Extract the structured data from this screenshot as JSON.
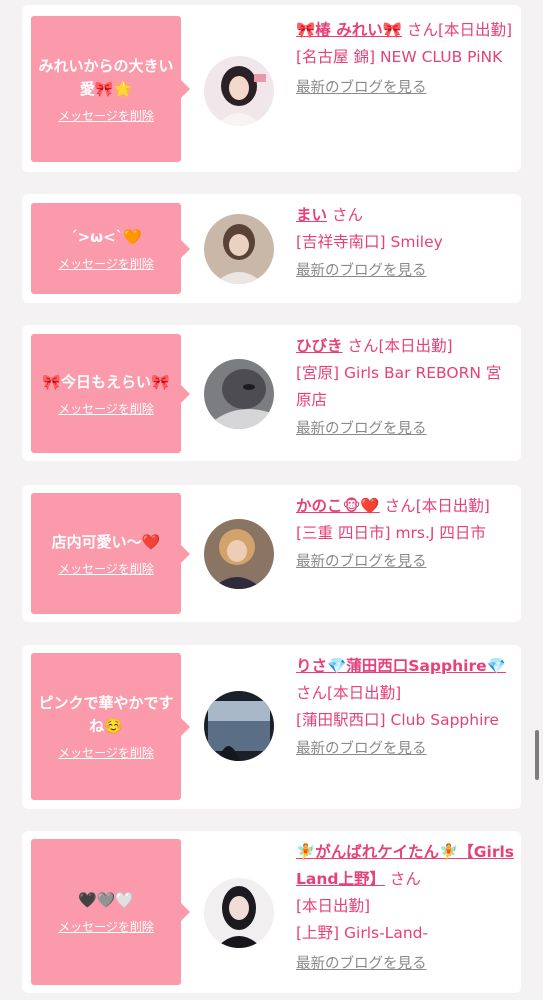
{
  "cards": [
    {
      "bubble_message": "みれいからの大きい愛🎀🌟",
      "delete_label": "メッセージを削除",
      "name": "🎀椿 みれい🎀",
      "honorific": "さん",
      "status": "[本日出勤]",
      "shop": "[名古屋 錦] NEW CLUB PiNK",
      "blog_label": "最新のブログを見る",
      "avatar_color": "#d8c4c8"
    },
    {
      "bubble_message": "´>ω<`🧡",
      "delete_label": "メッセージを削除",
      "name": "まい",
      "honorific": "さん",
      "status": "",
      "shop": "[吉祥寺南口] Smiley",
      "blog_label": "最新のブログを見る",
      "avatar_color": "#b9a79a"
    },
    {
      "bubble_message": "🎀今日もえらい🎀",
      "delete_label": "メッセージを削除",
      "name": "ひびき",
      "honorific": "さん",
      "status": "[本日出勤]",
      "shop": "[宮原] Girls Bar REBORN 宮原店",
      "blog_label": "最新のブログを見る",
      "avatar_color": "#8c8c8e"
    },
    {
      "bubble_message": "店内可愛い〜❤️",
      "delete_label": "メッセージを削除",
      "name": "かのこ🐵❤️",
      "honorific": "さん",
      "status": "[本日出勤]",
      "shop": "[三重 四日市] mrs.J 四日市",
      "blog_label": "最新のブログを見る",
      "avatar_color": "#a08870"
    },
    {
      "bubble_message": "ピンクで華やかですね☺️",
      "delete_label": "メッセージを削除",
      "name": "りさ💎蒲田西口Sapphire💎",
      "honorific": "さん",
      "status": "[本日出勤]",
      "shop": "[蒲田駅西口] Club Sapphire",
      "blog_label": "最新のブログを見る",
      "avatar_color": "#2d3a4a"
    },
    {
      "bubble_message": "🖤🩶🤍",
      "delete_label": "メッセージを削除",
      "name": "🧚がんばれケイたん🧚【Girls Land上野】",
      "honorific": "さん",
      "status": "[本日出勤]",
      "shop": "[上野] Girls-Land-",
      "blog_label": "最新のブログを見る",
      "avatar_color": "#e8e4e6"
    }
  ]
}
